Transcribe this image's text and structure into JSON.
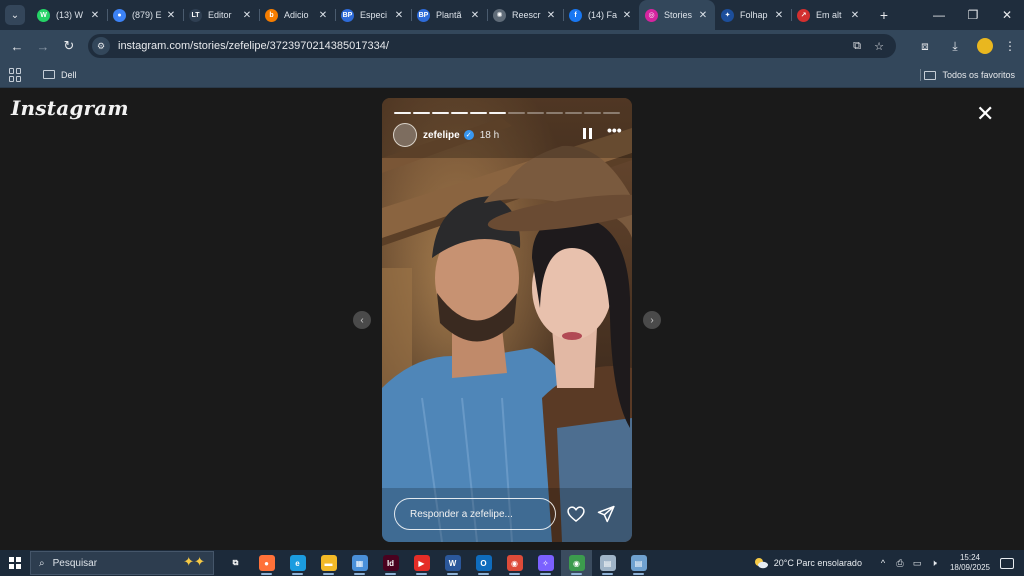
{
  "browser": {
    "tabs": [
      {
        "title": "(13) W",
        "favicon": "whatsapp-icon",
        "color": "#25d366",
        "glyph": "W"
      },
      {
        "title": "(879) E",
        "favicon": "globe-icon",
        "color": "#3c82f6",
        "glyph": "●"
      },
      {
        "title": "Editor",
        "favicon": "editor-icon",
        "color": "#2f3f52",
        "glyph": "LT"
      },
      {
        "title": "Adicio",
        "favicon": "blogger-icon",
        "color": "#f57d00",
        "glyph": "b"
      },
      {
        "title": "Especi",
        "favicon": "bp-icon",
        "color": "#2e6bd8",
        "glyph": "BP"
      },
      {
        "title": "Plantã",
        "favicon": "bp-icon",
        "color": "#2e6bd8",
        "glyph": "BP"
      },
      {
        "title": "Reescr",
        "favicon": "openai-icon",
        "color": "#5f6b78",
        "glyph": "✺"
      },
      {
        "title": "(14) Fa",
        "favicon": "facebook-icon",
        "color": "#1877f2",
        "glyph": "f"
      },
      {
        "title": "Stories",
        "favicon": "instagram-icon",
        "color": "#d6249f",
        "glyph": "◎",
        "active": true
      },
      {
        "title": "Folhap",
        "favicon": "folha-icon",
        "color": "#1c4e9b",
        "glyph": "✦"
      },
      {
        "title": "Em alt",
        "favicon": "trend-icon",
        "color": "#d32f2f",
        "glyph": "↗"
      }
    ],
    "new_tab": "+",
    "window": {
      "minimize": "—",
      "maximize": "❐",
      "close": "✕"
    },
    "url": "instagram.com/stories/zefelipe/3723970214385017334/",
    "bookmarks": {
      "folder": "Dell",
      "all": "Todos os favoritos"
    }
  },
  "instagram": {
    "logo": "Instagram",
    "close": "✕",
    "story": {
      "username": "zefelipe",
      "time": "18 h",
      "reply_placeholder": "Responder a zefelipe...",
      "segments_total": 12,
      "segments_done": 6,
      "more": "•••"
    },
    "prev_arrow": "‹",
    "next_arrow": "›"
  },
  "taskbar": {
    "search_placeholder": "Pesquisar",
    "weather": "20°C  Parc ensolarado",
    "time": "15:24",
    "date": "18/09/2025",
    "apps": [
      {
        "name": "taskview-icon",
        "color": "#1c2a3a",
        "glyph": "⧉"
      },
      {
        "name": "firefox-icon",
        "color": "#ff7139",
        "glyph": "●"
      },
      {
        "name": "edge-icon",
        "color": "#1b9ce0",
        "glyph": "e"
      },
      {
        "name": "file-explorer-icon",
        "color": "#f2b927",
        "glyph": "▬"
      },
      {
        "name": "store-icon",
        "color": "#4a90d9",
        "glyph": "▦"
      },
      {
        "name": "indesign-icon",
        "color": "#49021f",
        "glyph": "Id"
      },
      {
        "name": "youtube-icon",
        "color": "#e52d27",
        "glyph": "▶"
      },
      {
        "name": "word-icon",
        "color": "#2b579a",
        "glyph": "W"
      },
      {
        "name": "outlook-icon",
        "color": "#0f6cbd",
        "glyph": "O"
      },
      {
        "name": "chrome-icon",
        "color": "#dd4b39",
        "glyph": "◉"
      },
      {
        "name": "copilot-icon",
        "color": "#7b61ff",
        "glyph": "✧"
      },
      {
        "name": "chrome-icon-2",
        "color": "#3c9b4d",
        "glyph": "◉"
      },
      {
        "name": "notepad-icon",
        "color": "#9fb4c8",
        "glyph": "▤"
      },
      {
        "name": "notepad-icon-2",
        "color": "#6fa1d0",
        "glyph": "▤"
      }
    ]
  }
}
